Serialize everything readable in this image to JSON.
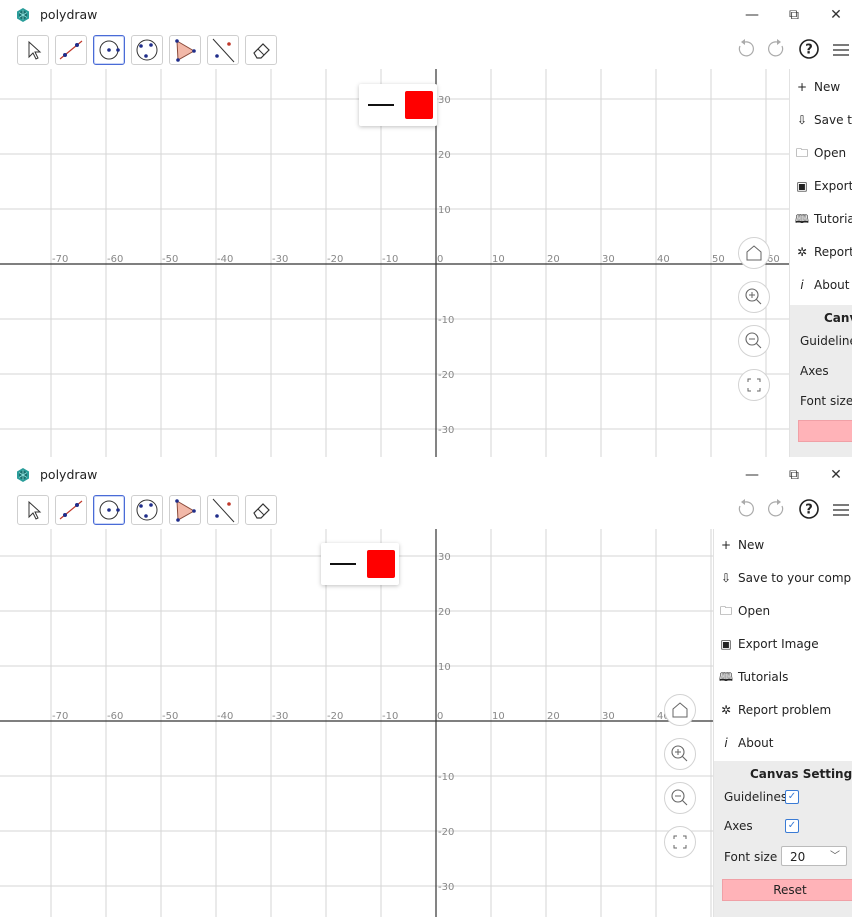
{
  "app": {
    "title": "polydraw"
  },
  "window_controls": {
    "minimize": "—",
    "restore": "⧉",
    "close": "✕"
  },
  "toolbar": {
    "tools": [
      {
        "name": "select-tool",
        "icon": "cursor-icon"
      },
      {
        "name": "line-tool",
        "icon": "line-segment-icon"
      },
      {
        "name": "circle-tool",
        "icon": "circle-center-icon"
      },
      {
        "name": "circle-3pt-tool",
        "icon": "circle-three-points-icon"
      },
      {
        "name": "polygon-tool",
        "icon": "polygon-icon"
      },
      {
        "name": "perpendicular-tool",
        "icon": "line-point-icon"
      },
      {
        "name": "eraser-tool",
        "icon": "eraser-icon"
      }
    ],
    "selected_tool": "circle-tool",
    "right": [
      "undo-icon",
      "redo-icon",
      "help-icon",
      "menu-icon"
    ]
  },
  "style_popup": {
    "line_style": "solid",
    "color": "#ff0000"
  },
  "axes": {
    "x_labels": [
      "-70",
      "-60",
      "-50",
      "-40",
      "-30",
      "-20",
      "-10",
      "0",
      "10",
      "20",
      "30",
      "40",
      "50",
      "60"
    ],
    "y_labels": [
      "30",
      "20",
      "10",
      "-10",
      "-20",
      "-30"
    ]
  },
  "menu": {
    "items": [
      {
        "icon": "+",
        "label": "New"
      },
      {
        "icon": "save-icon",
        "label": "Save to your computer"
      },
      {
        "icon": "folder-icon",
        "label": "Open"
      },
      {
        "icon": "image-icon",
        "label": "Export Image"
      },
      {
        "icon": "book-icon",
        "label": "Tutorials"
      },
      {
        "icon": "bug-icon",
        "label": "Report problem"
      },
      {
        "icon": "i",
        "label": "About"
      }
    ],
    "canvas_settings": {
      "title": "Canvas Settings",
      "guidelines_label": "Guidelines",
      "guidelines_checked": true,
      "axes_label": "Axes",
      "axes_checked": true,
      "font_size_label": "Font size",
      "font_size_value": "20",
      "reset_label": "Reset"
    }
  },
  "top_view_truncated": {
    "save": "Save to y",
    "export": "Export In",
    "report": "Report p",
    "settings_title": "Canva",
    "reset": "R"
  }
}
